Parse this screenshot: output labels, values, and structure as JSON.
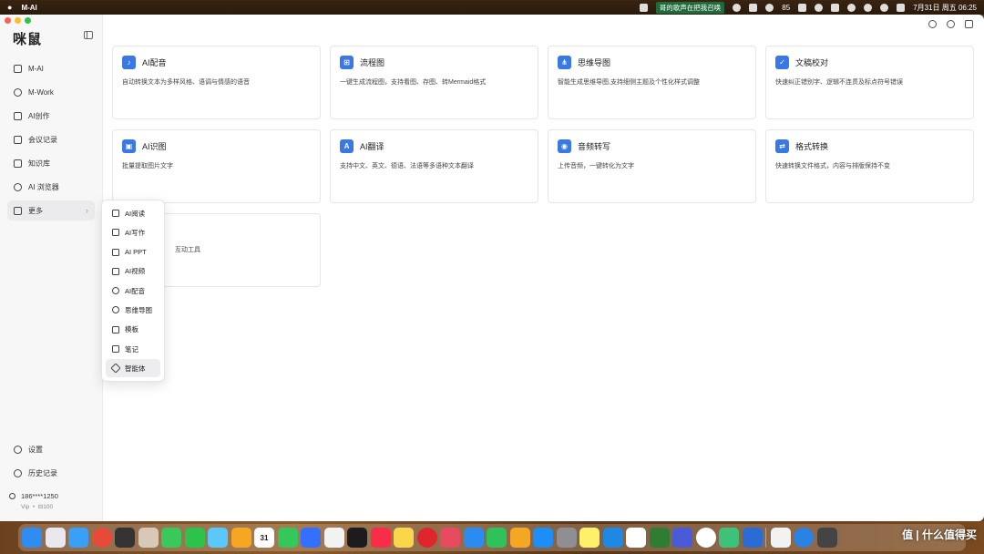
{
  "menubar": {
    "app_name": "M-AI",
    "song": "哥的歌声在把我召唤",
    "battery": "85",
    "datetime": "7月31日 周五 06:25"
  },
  "sidebar": {
    "logo": "咪鼠",
    "items": [
      {
        "label": "M-AI",
        "icon": "chat-icon"
      },
      {
        "label": "M-Work",
        "icon": "work-icon"
      },
      {
        "label": "AI创作",
        "icon": "image-icon"
      },
      {
        "label": "会议记录",
        "icon": "note-icon"
      },
      {
        "label": "知识库",
        "icon": "book-icon"
      },
      {
        "label": "AI 浏览器",
        "icon": "compass-icon"
      },
      {
        "label": "更多",
        "icon": "grid-icon"
      }
    ],
    "bottom": [
      {
        "label": "设置",
        "icon": "gear-icon"
      },
      {
        "label": "历史记录",
        "icon": "clock-icon"
      }
    ],
    "user": {
      "phone": "186****1250",
      "level": "Vip",
      "points": "100"
    }
  },
  "cards": [
    {
      "title": "AI配音",
      "desc": "自动转换文本为多样风格、语调与情感的语音",
      "icon": "voice-icon"
    },
    {
      "title": "流程图",
      "desc": "一键生成流程图，支持看图、存图、转Mermaid格式",
      "icon": "flowchart-icon"
    },
    {
      "title": "思维导图",
      "desc": "智能生成思维导图,支持细侧主题及个性化样式调整",
      "icon": "mindmap-icon"
    },
    {
      "title": "文稿校对",
      "desc": "快速纠正错别字、逻辑不连贯及标点符号错误",
      "icon": "proofread-icon"
    },
    {
      "title": "AI识图",
      "desc": "批量提取图片文字",
      "icon": "ocr-icon"
    },
    {
      "title": "AI翻译",
      "desc": "支持中文、英文、德语、法语等多语种文本翻译",
      "icon": "translate-icon"
    },
    {
      "title": "音频转写",
      "desc": "上传音频，一键转化为文字",
      "icon": "audio-icon"
    },
    {
      "title": "格式转换",
      "desc": "快速转换文件格式，内容与排版保持不变",
      "icon": "convert-icon"
    },
    {
      "title": "",
      "desc": "互动工具",
      "icon": "tool-icon"
    }
  ],
  "popup": {
    "items": [
      {
        "label": "AI阅读",
        "icon": "read-icon"
      },
      {
        "label": "AI写作",
        "icon": "write-icon"
      },
      {
        "label": "AI PPT",
        "icon": "ppt-icon"
      },
      {
        "label": "AI视频",
        "icon": "video-icon"
      },
      {
        "label": "AI配音",
        "icon": "mic-icon"
      },
      {
        "label": "思维导图",
        "icon": "mindmap-icon"
      },
      {
        "label": "模板",
        "icon": "template-icon"
      },
      {
        "label": "笔记",
        "icon": "notebook-icon"
      },
      {
        "label": "智能体",
        "icon": "layers-icon"
      }
    ]
  },
  "dock": {
    "calendar_day": "31"
  },
  "watermark": "值 | 什么值得买",
  "colors": {
    "accent": "#3a78e6",
    "sidebar_bg": "#f7f7f8"
  }
}
